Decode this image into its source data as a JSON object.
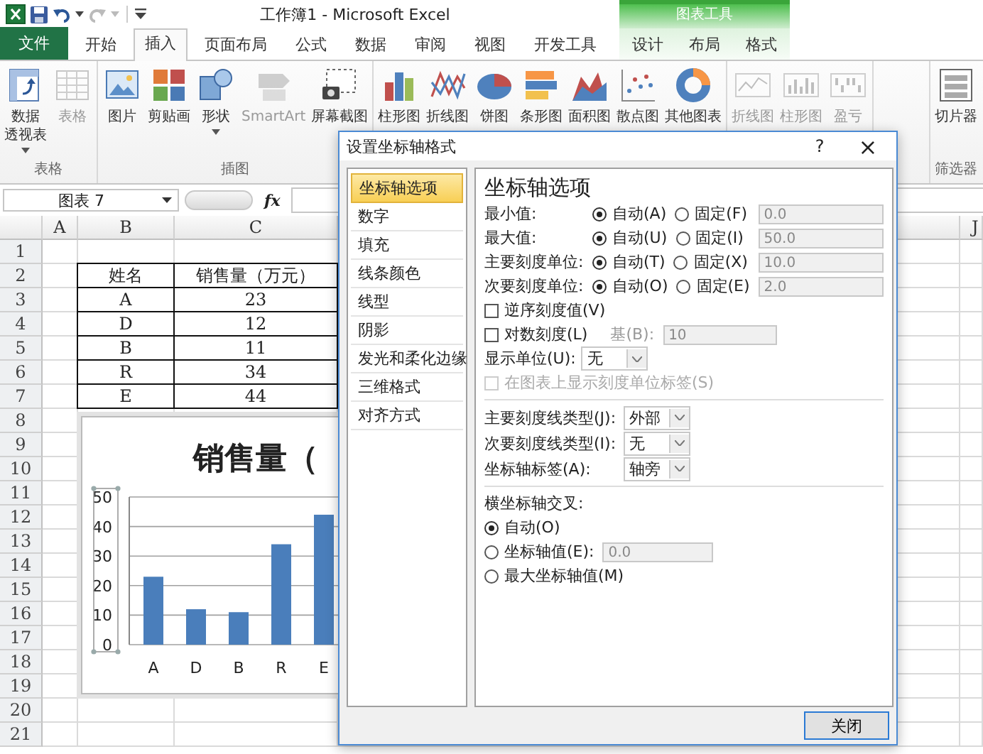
{
  "title_bar": {
    "title": "工作簿1 - Microsoft Excel",
    "context_title": "图表工具"
  },
  "tabs": [
    {
      "label": "文件",
      "kind": "file",
      "selected": false
    },
    {
      "label": "开始",
      "kind": "main",
      "selected": false
    },
    {
      "label": "插入",
      "kind": "main",
      "selected": true
    },
    {
      "label": "页面布局",
      "kind": "main",
      "selected": false
    },
    {
      "label": "公式",
      "kind": "main",
      "selected": false
    },
    {
      "label": "数据",
      "kind": "main",
      "selected": false
    },
    {
      "label": "审阅",
      "kind": "main",
      "selected": false
    },
    {
      "label": "视图",
      "kind": "main",
      "selected": false
    },
    {
      "label": "开发工具",
      "kind": "main",
      "selected": false
    },
    {
      "label": "设计",
      "kind": "context",
      "selected": false
    },
    {
      "label": "布局",
      "kind": "context",
      "selected": false
    },
    {
      "label": "格式",
      "kind": "context",
      "selected": false
    }
  ],
  "ribbon": {
    "groups": [
      {
        "label": "表格",
        "buttons": [
          {
            "lines": [
              "数据",
              "透视表"
            ],
            "kind": "pivot",
            "disabled": false,
            "dropdown": true
          },
          {
            "lines": [
              "表格"
            ],
            "kind": "table",
            "disabled": true,
            "dropdown": false
          }
        ]
      },
      {
        "label": "插图",
        "buttons": [
          {
            "lines": [
              "图片"
            ],
            "kind": "picture",
            "disabled": false,
            "dropdown": false
          },
          {
            "lines": [
              "剪贴画"
            ],
            "kind": "clipart",
            "disabled": false,
            "dropdown": false
          },
          {
            "lines": [
              "形状"
            ],
            "kind": "shapes",
            "disabled": false,
            "dropdown": true
          },
          {
            "lines": [
              "SmartArt"
            ],
            "kind": "smartart",
            "disabled": true,
            "dropdown": false
          },
          {
            "lines": [
              "屏幕截图"
            ],
            "kind": "screenshot",
            "disabled": false,
            "dropdown": false
          }
        ]
      },
      {
        "buttons": [
          {
            "lines": [
              "柱形图"
            ],
            "kind": "column",
            "disabled": false,
            "dropdown": false
          },
          {
            "lines": [
              "折线图"
            ],
            "kind": "line",
            "disabled": false,
            "dropdown": false
          },
          {
            "lines": [
              "饼图"
            ],
            "kind": "pie",
            "disabled": false,
            "dropdown": false
          },
          {
            "lines": [
              "条形图"
            ],
            "kind": "bar",
            "disabled": false,
            "dropdown": false
          },
          {
            "lines": [
              "面积图"
            ],
            "kind": "area",
            "disabled": false,
            "dropdown": false
          },
          {
            "lines": [
              "散点图"
            ],
            "kind": "scatter",
            "disabled": false,
            "dropdown": false
          },
          {
            "lines": [
              "其他图表"
            ],
            "kind": "other",
            "disabled": false,
            "dropdown": false
          }
        ]
      },
      {
        "buttons": [
          {
            "lines": [
              "折线图"
            ],
            "kind": "spark-line",
            "disabled": true,
            "dropdown": false
          },
          {
            "lines": [
              "柱形图"
            ],
            "kind": "spark-column",
            "disabled": true,
            "dropdown": false
          },
          {
            "lines": [
              "盈亏"
            ],
            "kind": "spark-winloss",
            "disabled": true,
            "dropdown": false
          }
        ]
      },
      {
        "label": "筛选器",
        "buttons": [
          {
            "lines": [
              "切片器"
            ],
            "kind": "slicer",
            "disabled": false,
            "dropdown": false
          }
        ]
      }
    ]
  },
  "formula_bar": {
    "name_box": "图表 7",
    "fx": "fx"
  },
  "sheet": {
    "columns": [
      {
        "label": "A"
      },
      {
        "label": "B"
      },
      {
        "label": "C"
      },
      {
        "label": "J"
      }
    ],
    "rows": [
      "1",
      "2",
      "3",
      "4",
      "5",
      "6",
      "7",
      "8",
      "9",
      "10",
      "11",
      "12",
      "13",
      "14",
      "15",
      "16",
      "17",
      "18",
      "19",
      "20",
      "21"
    ],
    "table": {
      "header": [
        "姓名",
        "销售量（万元）"
      ],
      "rows": [
        [
          "A",
          "23"
        ],
        [
          "D",
          "12"
        ],
        [
          "B",
          "11"
        ],
        [
          "R",
          "34"
        ],
        [
          "E",
          "44"
        ]
      ]
    },
    "chart": {
      "chart_data": {
        "type": "bar",
        "grid": true,
        "title": "销售量（",
        "categories": [
          "A",
          "D",
          "B",
          "R",
          "E"
        ],
        "values": [
          23,
          12,
          11,
          34,
          44
        ],
        "ylim": [
          0,
          50
        ],
        "yticks": [
          0,
          10,
          20,
          30,
          40,
          50
        ]
      }
    }
  },
  "dialog": {
    "title": "设置坐标轴格式",
    "help": "?",
    "close": "×",
    "nav": [
      {
        "label": "坐标轴选项",
        "selected": true
      },
      {
        "label": "数字",
        "selected": false
      },
      {
        "label": "填充",
        "selected": false
      },
      {
        "label": "线条颜色",
        "selected": false
      },
      {
        "label": "线型",
        "selected": false
      },
      {
        "label": "阴影",
        "selected": false
      },
      {
        "label": "发光和柔化边缘",
        "selected": false
      },
      {
        "label": "三维格式",
        "selected": false
      },
      {
        "label": "对齐方式",
        "selected": false
      }
    ],
    "heading": "坐标轴选项",
    "bounds": [
      {
        "label": "最小值:",
        "options": [
          {
            "label": "自动(A)",
            "selected": true
          },
          {
            "label": "固定(F)",
            "selected": false
          }
        ],
        "value": "0.0"
      },
      {
        "label": "最大值:",
        "options": [
          {
            "label": "自动(U)",
            "selected": true
          },
          {
            "label": "固定(I)",
            "selected": false
          }
        ],
        "value": "50.0"
      },
      {
        "label": "主要刻度单位:",
        "options": [
          {
            "label": "自动(T)",
            "selected": true
          },
          {
            "label": "固定(X)",
            "selected": false
          }
        ],
        "value": "10.0"
      },
      {
        "label": "次要刻度单位:",
        "options": [
          {
            "label": "自动(O)",
            "selected": true
          },
          {
            "label": "固定(E)",
            "selected": false
          }
        ],
        "value": "2.0"
      }
    ],
    "reverse": {
      "label": "逆序刻度值(V)",
      "checked": false
    },
    "log": {
      "label": "对数刻度(L)",
      "checked": false,
      "base_label": "基(B):",
      "base_value": "10"
    },
    "display_unit": {
      "label": "显示单位(U):",
      "value": "无"
    },
    "unit_label": {
      "label": "在图表上显示刻度单位标签(S)",
      "checked": false,
      "disabled": true
    },
    "tick_selects": [
      {
        "label": "主要刻度线类型(J):",
        "value": "外部"
      },
      {
        "label": "次要刻度线类型(I):",
        "value": "无"
      },
      {
        "label": "坐标轴标签(A):",
        "value": "轴旁"
      }
    ],
    "cross": {
      "label": "横坐标轴交叉:",
      "options": [
        {
          "label": "自动(O)",
          "selected": true
        },
        {
          "label": "坐标轴值(E):",
          "selected": false,
          "value": "0.0"
        },
        {
          "label": "最大坐标轴值(M)",
          "selected": false
        }
      ]
    },
    "close_button": "关闭"
  }
}
